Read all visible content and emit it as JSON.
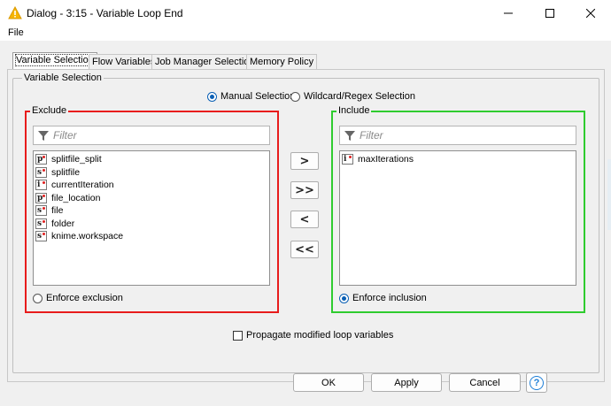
{
  "window": {
    "title": "Dialog - 3:15 - Variable Loop End"
  },
  "menu": {
    "file": "File"
  },
  "tabs": [
    {
      "label": "Variable Selection",
      "active": true
    },
    {
      "label": "Flow Variables",
      "active": false
    },
    {
      "label": "Job Manager Selection",
      "active": false
    },
    {
      "label": "Memory Policy",
      "active": false
    }
  ],
  "group": {
    "label": "Variable Selection"
  },
  "mode": {
    "manual_label": "Manual Selection",
    "wildcard_label": "Wildcard/Regex Selection",
    "selected": "manual"
  },
  "exclude": {
    "label": "Exclude",
    "filter_placeholder": "Filter",
    "items": [
      {
        "type": "p",
        "name": "splitfile_split"
      },
      {
        "type": "s",
        "name": "splitfile"
      },
      {
        "type": "i",
        "name": "currentIteration"
      },
      {
        "type": "p",
        "name": "file_location"
      },
      {
        "type": "s",
        "name": "file"
      },
      {
        "type": "s",
        "name": "folder"
      },
      {
        "type": "s",
        "name": "knime.workspace"
      }
    ],
    "enforce_label": "Enforce exclusion",
    "enforce_selected": false,
    "border_color": "#e81c1c"
  },
  "include": {
    "label": "Include",
    "filter_placeholder": "Filter",
    "items": [
      {
        "type": "i",
        "name": "maxIterations"
      }
    ],
    "enforce_label": "Enforce inclusion",
    "enforce_selected": true,
    "border_color": "#2fcc2f"
  },
  "transfer_buttons": [
    ">",
    ">>",
    "<",
    "<<"
  ],
  "propagate": {
    "label": "Propagate modified loop variables",
    "checked": false
  },
  "buttons": {
    "ok": "OK",
    "apply": "Apply",
    "cancel": "Cancel",
    "help": "?"
  },
  "colors": {
    "accent": "#0a5fb4",
    "help": "#1e7fd8"
  }
}
